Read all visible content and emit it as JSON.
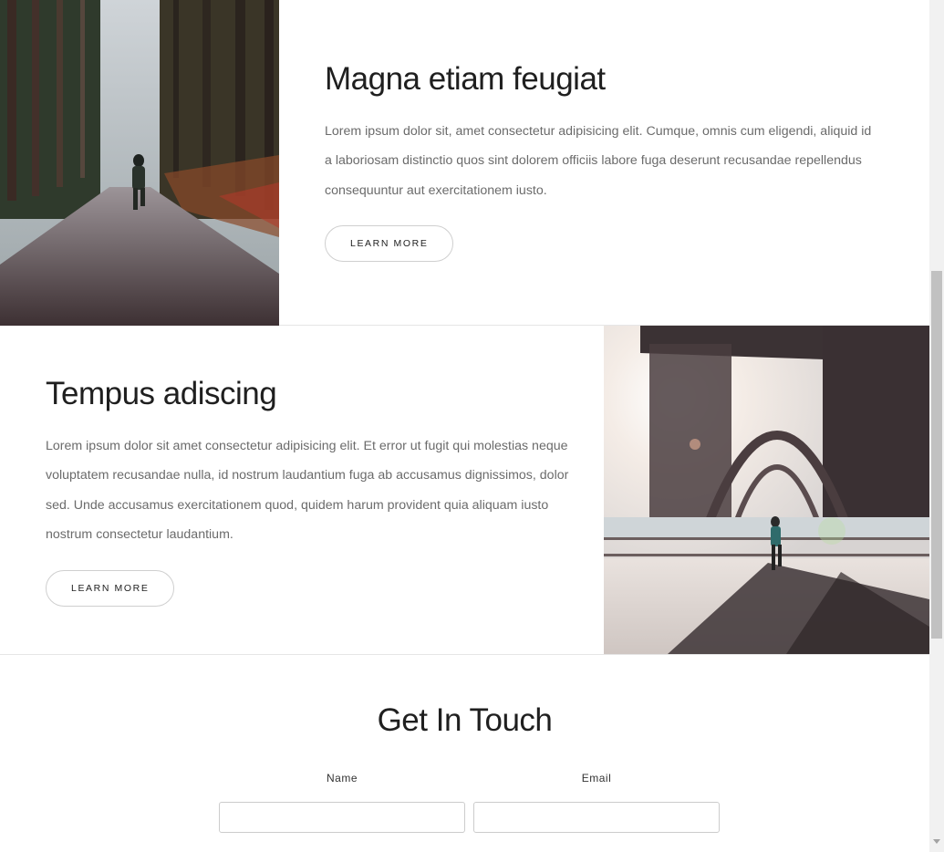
{
  "feature1": {
    "image_alt": "Hiker running on a forest trail",
    "title": "Magna etiam feugiat",
    "body": "Lorem ipsum dolor sit, amet consectetur adipisicing elit. Cumque, omnis cum eligendi, aliquid id a laboriosam distinctio quos sint dolorem officiis labore fuga deserunt recusandae repellendus consequuntur aut exercitationem iusto.",
    "button_label": "LEARN MORE"
  },
  "feature2": {
    "image_alt": "Runner under a steel bridge at sunrise",
    "title": "Tempus adiscing",
    "body": "Lorem ipsum dolor sit amet consectetur adipisicing elit. Et error ut fugit qui molestias neque voluptatem recusandae nulla, id nostrum laudantium fuga ab accusamus dignissimos, dolor sed. Unde accusamus exercitationem quod, quidem harum provident quia aliquam iusto nostrum consectetur laudantium.",
    "button_label": "LEARN MORE"
  },
  "contact": {
    "title": "Get In Touch",
    "name_label": "Name",
    "email_label": "Email",
    "name_value": "",
    "email_value": ""
  }
}
